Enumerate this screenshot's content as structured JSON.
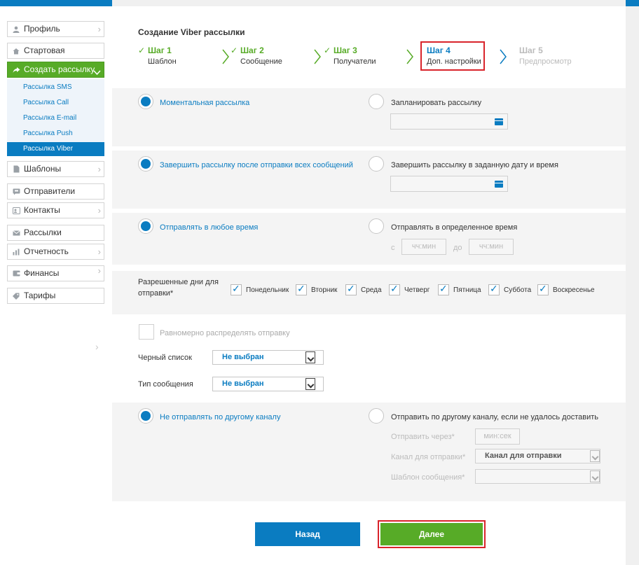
{
  "sidebar": {
    "items": [
      {
        "label": "Профиль",
        "icon": "user-icon",
        "chevron": true
      },
      {
        "label": "Стартовая",
        "icon": "home-icon",
        "chevron": false
      },
      {
        "label": "Создать рассылку",
        "icon": "share-arrow-icon",
        "chevron": true
      },
      {
        "label": "Шаблоны",
        "icon": "document-icon",
        "chevron": true
      },
      {
        "label": "Отправители",
        "icon": "sender-icon",
        "chevron": false
      },
      {
        "label": "Контакты",
        "icon": "contacts-icon",
        "chevron": true
      },
      {
        "label": "Рассылки",
        "icon": "mail-icon",
        "chevron": false
      },
      {
        "label": "Отчетность",
        "icon": "report-icon",
        "chevron": true
      },
      {
        "label": "Финансы",
        "icon": "wallet-icon",
        "chevron": false
      },
      {
        "label": "Тарифы",
        "icon": "tag-icon",
        "chevron": false
      }
    ],
    "subitems": [
      {
        "label": "Рассылка SMS"
      },
      {
        "label": "Рассылка Call"
      },
      {
        "label": "Рассылка E-mail"
      },
      {
        "label": "Рассылка Push"
      },
      {
        "label": "Рассылка Viber"
      }
    ]
  },
  "page": {
    "title": "Создание Viber рассылки",
    "steps": [
      {
        "title": "Шаг 1",
        "sub": "Шаблон"
      },
      {
        "title": "Шаг 2",
        "sub": "Сообщение"
      },
      {
        "title": "Шаг 3",
        "sub": "Получатели"
      },
      {
        "title": "Шаг 4",
        "sub": "Доп. настройки"
      },
      {
        "title": "Шаг 5",
        "sub": "Предпросмотр"
      }
    ]
  },
  "send_time": {
    "instant": "Моментальная рассылка",
    "scheduled": "Запланировать рассылку"
  },
  "finish": {
    "after_all": "Завершить рассылку после отправки всех сообщений",
    "at_date": "Завершить рассылку в заданную дату и время"
  },
  "time_window": {
    "any_time": "Отправлять в любое время",
    "specific_time": "Отправлять в определенное время",
    "from": "с",
    "to": "до",
    "placeholder": "чч:мин"
  },
  "days": {
    "label": "Разрешенные дни для отправки*",
    "list": [
      "Понедельник",
      "Вторник",
      "Среда",
      "Четверг",
      "Пятница",
      "Суббота",
      "Воскресенье"
    ]
  },
  "options": {
    "even_distribution": "Равномерно распределять отправку",
    "blacklist_label": "Черный список",
    "blacklist_value": "Не выбран",
    "msg_type_label": "Тип сообщения",
    "msg_type_value": "Не выбран"
  },
  "fallback": {
    "none": "Не отправлять по другому каналу",
    "other": "Отправить по другому каналу, если не удалось доставить",
    "send_via": "Отправить через*",
    "send_via_placeholder": "мин:сек",
    "channel_label": "Канал для отправки*",
    "channel_value": "Канал для отправки",
    "template_label": "Шаблон сообщения*"
  },
  "buttons": {
    "back": "Назад",
    "next": "Далее"
  },
  "colors": {
    "primary_blue": "#0a7cc1",
    "green": "#57ab27",
    "highlight_red": "#d9242b"
  }
}
